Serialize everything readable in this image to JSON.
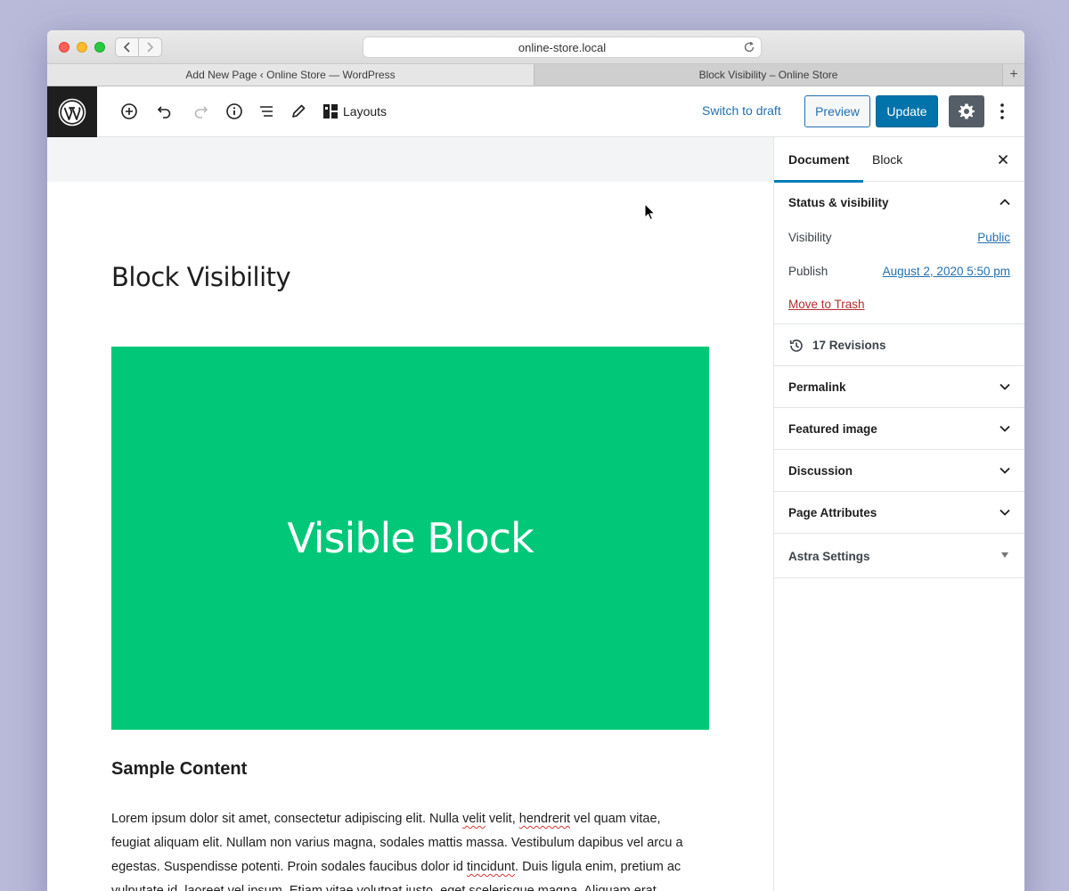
{
  "browser": {
    "url": "online-store.local",
    "tabs": [
      {
        "label": "Add New Page ‹ Online Store — WordPress"
      },
      {
        "label": "Block Visibility – Online Store"
      }
    ],
    "new_tab_label": "+"
  },
  "toolbar": {
    "icons": [
      "add-block-icon",
      "undo-icon",
      "redo-icon",
      "info-icon",
      "list-view-icon",
      "edit-icon",
      "layouts-icon"
    ],
    "layouts_label": "Layouts",
    "switch_to_draft_label": "Switch to draft",
    "preview_label": "Preview",
    "update_label": "Update"
  },
  "editor": {
    "title": "Block Visibility",
    "visible_block_text": "Visible Block",
    "visible_block_color": "#00c878",
    "heading": "Sample Content",
    "paragraph": [
      {
        "text": "Lorem ipsum dolor sit amet, consectetur adipiscing elit. Nulla ",
        "spell": false
      },
      {
        "text": "velit",
        "spell": true
      },
      {
        "text": " velit, ",
        "spell": false
      },
      {
        "text": "hendrerit",
        "spell": true
      },
      {
        "text": " vel quam vitae, feugiat aliquam elit. Nullam non varius magna, sodales mattis massa. Vestibulum dapibus vel arcu a egestas. Suspendisse potenti. Proin sodales faucibus dolor id ",
        "spell": false
      },
      {
        "text": "tincidunt",
        "spell": true
      },
      {
        "text": ". Duis ligula enim, pretium ac vulputate id, laoreet vel ipsum. Etiam vitae volutpat justo, eget scelerisque magna. Aliquam erat",
        "spell": false
      }
    ]
  },
  "sidebar": {
    "tabs": {
      "document": "Document",
      "block": "Block"
    },
    "status_visibility": {
      "title": "Status & visibility",
      "visibility_label": "Visibility",
      "visibility_value": "Public",
      "publish_label": "Publish",
      "publish_value": "August 2, 2020 5:50 pm",
      "trash_label": "Move to Trash"
    },
    "revisions_label": "17 Revisions",
    "panels": {
      "permalink": "Permalink",
      "featured_image": "Featured image",
      "discussion": "Discussion",
      "page_attributes": "Page Attributes",
      "astra_settings": "Astra Settings"
    }
  },
  "colors": {
    "accent": "#0073aa",
    "link": "#2271b1",
    "danger": "#b32d2e"
  }
}
